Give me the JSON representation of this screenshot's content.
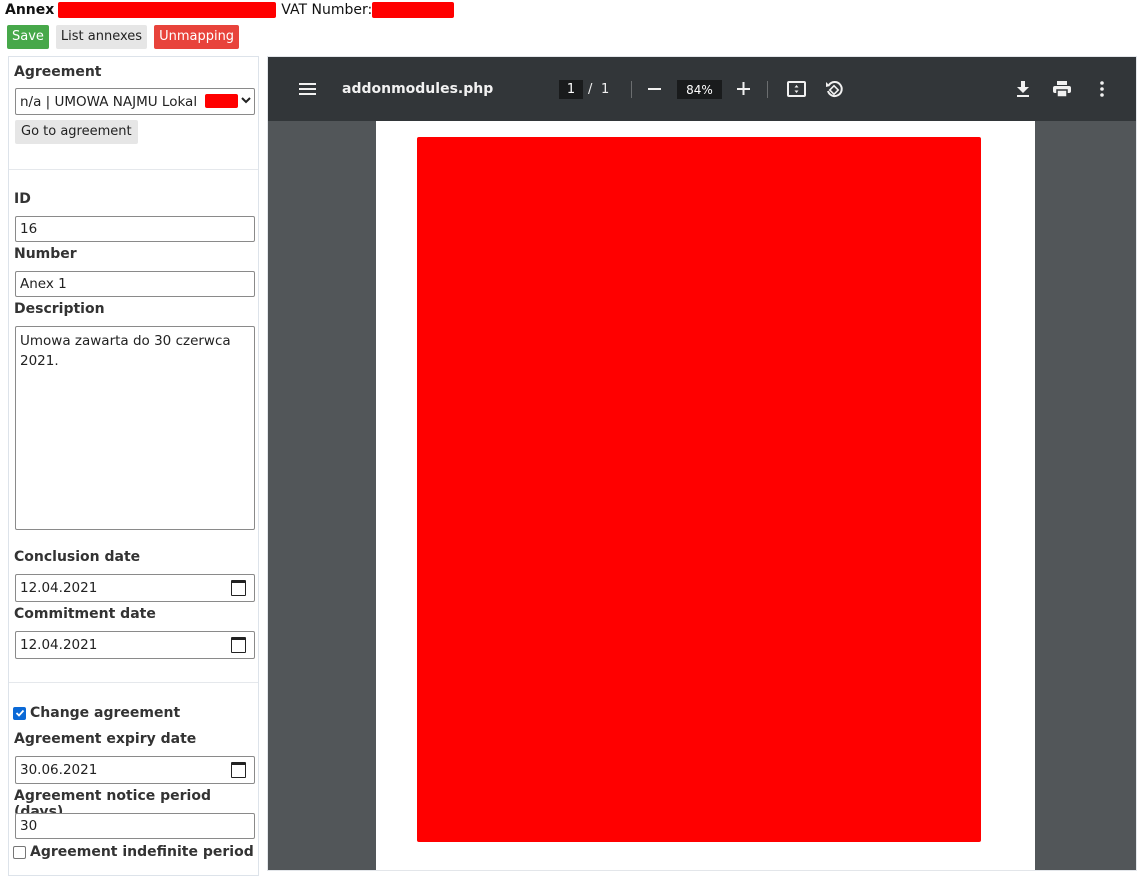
{
  "header": {
    "annex_label": "Annex",
    "vat_label": "VAT Number:"
  },
  "toolbar": {
    "save": "Save",
    "list_annexes": "List annexes",
    "unmapping": "Unmapping"
  },
  "colors": {
    "save": "#47a84a",
    "unmapping": "#e8433b",
    "redaction": "#ff0000",
    "viewer_toolbar": "#323639",
    "viewer_bg": "#525659"
  },
  "form": {
    "agreement_label": "Agreement",
    "agreement_value": "n/a | UMOWA NAJMU Lokal",
    "go_to_agreement": "Go to agreement",
    "id_label": "ID",
    "id_value": "16",
    "number_label": "Number",
    "number_value": "Anex 1",
    "description_label": "Description",
    "description_value": "Umowa zawarta do 30 czerwca 2021.",
    "conclusion_label": "Conclusion date",
    "conclusion_value": "12.04.2021",
    "commitment_label": "Commitment date",
    "commitment_value": "12.04.2021",
    "change_agreement_label": "Change agreement",
    "change_agreement_checked": true,
    "expiry_label": "Agreement expiry date",
    "expiry_value": "30.06.2021",
    "notice_label": "Agreement notice period (days)",
    "notice_value": "30",
    "indefinite_label": "Agreement indefinite period",
    "indefinite_checked": false
  },
  "viewer": {
    "title": "addonmodules.php",
    "page_current": "1",
    "page_sep": "/",
    "page_total": "1",
    "zoom": "84%",
    "icons": [
      "menu-icon",
      "zoom-out-icon",
      "zoom-in-icon",
      "fit-page-icon",
      "rotate-icon",
      "download-icon",
      "print-icon",
      "more-icon"
    ]
  }
}
